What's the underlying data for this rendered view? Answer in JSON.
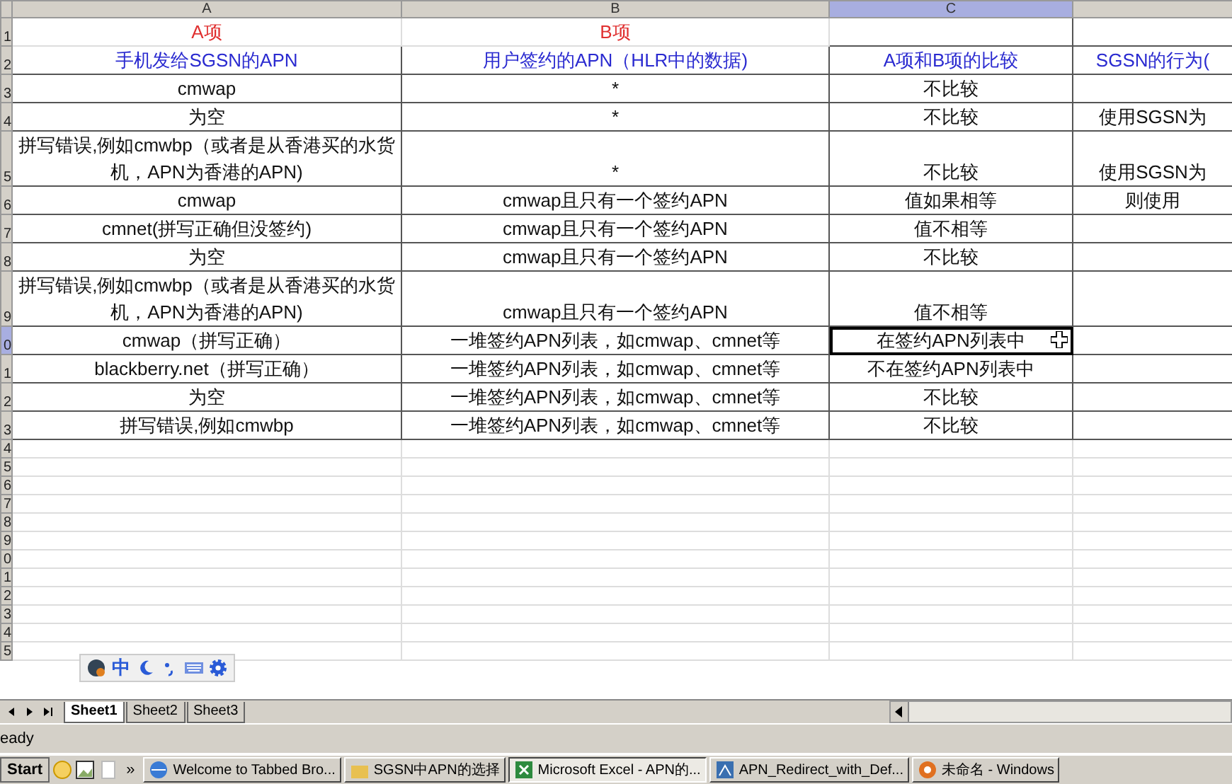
{
  "columns": [
    {
      "label": "A",
      "selected": false
    },
    {
      "label": "B",
      "selected": false
    },
    {
      "label": "C",
      "selected": true
    },
    {
      "selected": false
    }
  ],
  "rows": [
    {
      "number": "1",
      "selected": false,
      "cells": [
        {
          "kind": "title",
          "text": "A项"
        },
        {
          "kind": "title",
          "text": "B项"
        },
        {
          "kind": "body",
          "text": ""
        },
        {
          "kind": "body",
          "text": ""
        }
      ]
    },
    {
      "number": "2",
      "selected": false,
      "cells": [
        {
          "kind": "header",
          "text": "手机发给SGSN的APN"
        },
        {
          "kind": "header",
          "text": "用户签约的APN（HLR中的数据)"
        },
        {
          "kind": "header",
          "text": "A项和B项的比较"
        },
        {
          "kind": "header",
          "text": "SGSN的行为("
        }
      ]
    },
    {
      "number": "3",
      "selected": false,
      "cells": [
        {
          "kind": "body",
          "text": "cmwap"
        },
        {
          "kind": "body",
          "text": "*"
        },
        {
          "kind": "body",
          "text": "不比较"
        },
        {
          "kind": "body",
          "text": ""
        }
      ]
    },
    {
      "number": "4",
      "selected": false,
      "cells": [
        {
          "kind": "body",
          "text": "为空"
        },
        {
          "kind": "body",
          "text": "*"
        },
        {
          "kind": "body",
          "text": "不比较"
        },
        {
          "kind": "body",
          "text": "使用SGSN为"
        }
      ]
    },
    {
      "number": "5",
      "selected": false,
      "cells": [
        {
          "kind": "body",
          "text": "拼写错误,例如cmwbp（或者是从香港买的水货机，APN为香港的APN)"
        },
        {
          "kind": "body",
          "text": "*"
        },
        {
          "kind": "body",
          "text": "不比较"
        },
        {
          "kind": "body",
          "text": "使用SGSN为"
        }
      ]
    },
    {
      "number": "6",
      "selected": false,
      "cells": [
        {
          "kind": "body",
          "text": "cmwap"
        },
        {
          "kind": "body",
          "text": "cmwap且只有一个签约APN"
        },
        {
          "kind": "body",
          "text": "值如果相等"
        },
        {
          "kind": "body",
          "text": "则使用"
        }
      ]
    },
    {
      "number": "7",
      "selected": false,
      "cells": [
        {
          "kind": "body",
          "text": "cmnet(拼写正确但没签约)"
        },
        {
          "kind": "body",
          "text": "cmwap且只有一个签约APN"
        },
        {
          "kind": "body",
          "text": "值不相等"
        },
        {
          "kind": "body",
          "text": ""
        }
      ]
    },
    {
      "number": "8",
      "selected": false,
      "cells": [
        {
          "kind": "body",
          "text": "为空"
        },
        {
          "kind": "body",
          "text": "cmwap且只有一个签约APN"
        },
        {
          "kind": "body",
          "text": "不比较"
        },
        {
          "kind": "body",
          "text": ""
        }
      ]
    },
    {
      "number": "9",
      "selected": false,
      "cells": [
        {
          "kind": "body",
          "text": "拼写错误,例如cmwbp（或者是从香港买的水货机，APN为香港的APN)"
        },
        {
          "kind": "body",
          "text": "cmwap且只有一个签约APN"
        },
        {
          "kind": "body",
          "text": "值不相等"
        },
        {
          "kind": "body",
          "text": ""
        }
      ]
    },
    {
      "number": "0",
      "selected": true,
      "cells": [
        {
          "kind": "body",
          "text": "cmwap（拼写正确）"
        },
        {
          "kind": "body",
          "text": "一堆签约APN列表，如cmwap、cmnet等"
        },
        {
          "kind": "body",
          "text": "在签约APN列表中",
          "selected": true
        },
        {
          "kind": "body",
          "text": ""
        }
      ]
    },
    {
      "number": "1",
      "selected": false,
      "cells": [
        {
          "kind": "body",
          "text": "blackberry.net（拼写正确）"
        },
        {
          "kind": "body",
          "text": "一堆签约APN列表，如cmwap、cmnet等"
        },
        {
          "kind": "body",
          "text": "不在签约APN列表中"
        },
        {
          "kind": "body",
          "text": ""
        }
      ]
    },
    {
      "number": "2",
      "selected": false,
      "cells": [
        {
          "kind": "body",
          "text": "为空"
        },
        {
          "kind": "body",
          "text": "一堆签约APN列表，如cmwap、cmnet等"
        },
        {
          "kind": "body",
          "text": "不比较"
        },
        {
          "kind": "body",
          "text": ""
        }
      ]
    },
    {
      "number": "3",
      "selected": false,
      "cells": [
        {
          "kind": "body",
          "text": "拼写错误,例如cmwbp"
        },
        {
          "kind": "body",
          "text": "一堆签约APN列表，如cmwap、cmnet等"
        },
        {
          "kind": "body",
          "text": "不比较"
        },
        {
          "kind": "body",
          "text": ""
        }
      ]
    },
    {
      "number": "4",
      "selected": false,
      "cells": []
    },
    {
      "number": "5",
      "selected": false,
      "cells": []
    },
    {
      "number": "6",
      "selected": false,
      "cells": []
    },
    {
      "number": "7",
      "selected": false,
      "cells": []
    },
    {
      "number": "8",
      "selected": false,
      "cells": []
    },
    {
      "number": "9",
      "selected": false,
      "cells": []
    },
    {
      "number": "0",
      "selected": false,
      "cells": []
    },
    {
      "number": "1",
      "selected": false,
      "cells": []
    },
    {
      "number": "2",
      "selected": false,
      "cells": []
    },
    {
      "number": "3",
      "selected": false,
      "cells": []
    },
    {
      "number": "4",
      "selected": false,
      "cells": []
    },
    {
      "number": "5",
      "selected": false,
      "cells": []
    }
  ],
  "ime_toolbar": {
    "mode": "中"
  },
  "sheet_tabs": [
    {
      "label": "Sheet1",
      "selected": true
    },
    {
      "label": "Sheet2",
      "selected": false
    },
    {
      "label": "Sheet3",
      "selected": false
    }
  ],
  "status_bar": {
    "text": "eady"
  },
  "taskbar": {
    "start": "Start",
    "overflow": "»",
    "tasks": [
      {
        "kind": "browser",
        "label": "Welcome to Tabbed Bro...",
        "selected": false
      },
      {
        "kind": "folder",
        "label": "SGSN中APN的选择",
        "selected": false
      },
      {
        "kind": "sheet",
        "label": "Microsoft Excel - APN的...",
        "selected": true
      },
      {
        "kind": "diagram",
        "label": "APN_Redirect_with_Def...",
        "selected": false
      },
      {
        "kind": "media",
        "label": "未命名 - Windows",
        "selected": false
      }
    ]
  }
}
